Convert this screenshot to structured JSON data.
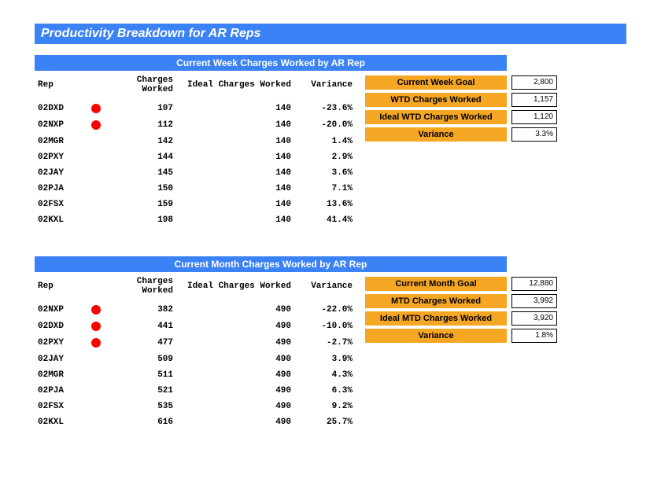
{
  "title": "Productivity Breakdown for AR Reps",
  "columns": {
    "rep": "Rep",
    "charges": "Charges Worked",
    "ideal": "Ideal Charges Worked",
    "variance": "Variance"
  },
  "week": {
    "header": "Current Week Charges Worked by AR Rep",
    "rows": [
      {
        "rep": "02DXD",
        "flag": true,
        "charges": "107",
        "ideal": "140",
        "variance": "-23.6%"
      },
      {
        "rep": "02NXP",
        "flag": true,
        "charges": "112",
        "ideal": "140",
        "variance": "-20.0%"
      },
      {
        "rep": "02MGR",
        "flag": false,
        "charges": "142",
        "ideal": "140",
        "variance": "1.4%"
      },
      {
        "rep": "02PXY",
        "flag": false,
        "charges": "144",
        "ideal": "140",
        "variance": "2.9%"
      },
      {
        "rep": "02JAY",
        "flag": false,
        "charges": "145",
        "ideal": "140",
        "variance": "3.6%"
      },
      {
        "rep": "02PJA",
        "flag": false,
        "charges": "150",
        "ideal": "140",
        "variance": "7.1%"
      },
      {
        "rep": "02FSX",
        "flag": false,
        "charges": "159",
        "ideal": "140",
        "variance": "13.6%"
      },
      {
        "rep": "02KXL",
        "flag": false,
        "charges": "198",
        "ideal": "140",
        "variance": "41.4%"
      }
    ],
    "summary": [
      {
        "label": "Current Week Goal",
        "value": "2,800"
      },
      {
        "label": "WTD Charges Worked",
        "value": "1,157"
      },
      {
        "label": "Ideal WTD Charges Worked",
        "value": "1,120"
      },
      {
        "label": "Variance",
        "value": "3.3%"
      }
    ]
  },
  "month": {
    "header": "Current Month Charges Worked by AR Rep",
    "rows": [
      {
        "rep": "02NXP",
        "flag": true,
        "charges": "382",
        "ideal": "490",
        "variance": "-22.0%"
      },
      {
        "rep": "02DXD",
        "flag": true,
        "charges": "441",
        "ideal": "490",
        "variance": "-10.0%"
      },
      {
        "rep": "02PXY",
        "flag": true,
        "charges": "477",
        "ideal": "490",
        "variance": "-2.7%"
      },
      {
        "rep": "02JAY",
        "flag": false,
        "charges": "509",
        "ideal": "490",
        "variance": "3.9%"
      },
      {
        "rep": "02MGR",
        "flag": false,
        "charges": "511",
        "ideal": "490",
        "variance": "4.3%"
      },
      {
        "rep": "02PJA",
        "flag": false,
        "charges": "521",
        "ideal": "490",
        "variance": "6.3%"
      },
      {
        "rep": "02FSX",
        "flag": false,
        "charges": "535",
        "ideal": "490",
        "variance": "9.2%"
      },
      {
        "rep": "02KXL",
        "flag": false,
        "charges": "616",
        "ideal": "490",
        "variance": "25.7%"
      }
    ],
    "summary": [
      {
        "label": "Current Month Goal",
        "value": "12,880"
      },
      {
        "label": "MTD Charges Worked",
        "value": "3,992"
      },
      {
        "label": "Ideal MTD Charges Worked",
        "value": "3,920"
      },
      {
        "label": "Variance",
        "value": "1.8%"
      }
    ]
  },
  "chart_data": [
    {
      "type": "table",
      "title": "Current Week Charges Worked by AR Rep",
      "columns": [
        "Rep",
        "Charges Worked",
        "Ideal Charges Worked",
        "Variance"
      ],
      "rows": [
        [
          "02DXD",
          107,
          140,
          -23.6
        ],
        [
          "02NXP",
          112,
          140,
          -20.0
        ],
        [
          "02MGR",
          142,
          140,
          1.4
        ],
        [
          "02PXY",
          144,
          140,
          2.9
        ],
        [
          "02JAY",
          145,
          140,
          3.6
        ],
        [
          "02PJA",
          150,
          140,
          7.1
        ],
        [
          "02FSX",
          159,
          140,
          13.6
        ],
        [
          "02KXL",
          198,
          140,
          41.4
        ]
      ],
      "totals": {
        "goal": 2800,
        "wtd": 1157,
        "ideal_wtd": 1120,
        "variance_pct": 3.3
      }
    },
    {
      "type": "table",
      "title": "Current Month Charges Worked by AR Rep",
      "columns": [
        "Rep",
        "Charges Worked",
        "Ideal Charges Worked",
        "Variance"
      ],
      "rows": [
        [
          "02NXP",
          382,
          490,
          -22.0
        ],
        [
          "02DXD",
          441,
          490,
          -10.0
        ],
        [
          "02PXY",
          477,
          490,
          -2.7
        ],
        [
          "02JAY",
          509,
          490,
          3.9
        ],
        [
          "02MGR",
          511,
          490,
          4.3
        ],
        [
          "02PJA",
          521,
          490,
          6.3
        ],
        [
          "02FSX",
          535,
          490,
          9.2
        ],
        [
          "02KXL",
          616,
          490,
          25.7
        ]
      ],
      "totals": {
        "goal": 12880,
        "mtd": 3992,
        "ideal_mtd": 3920,
        "variance_pct": 1.8
      }
    }
  ]
}
